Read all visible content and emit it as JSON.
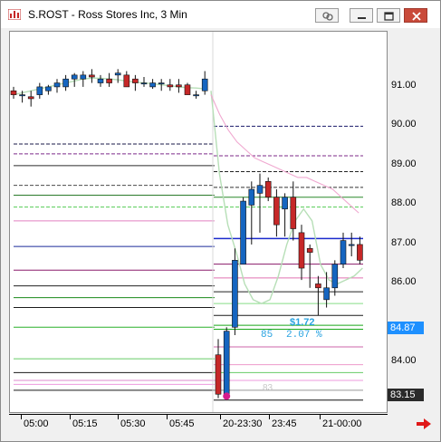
{
  "window": {
    "title": "S.ROST - Ross Stores Inc, 3 Min",
    "buttons": [
      "link",
      "minimize",
      "maximize",
      "close"
    ]
  },
  "chart_data": {
    "type": "candlestick",
    "symbol": "S.ROST",
    "name": "Ross Stores Inc",
    "interval": "3 Min",
    "ylim": [
      82.7,
      92.4
    ],
    "y_ticks": [
      "91.00",
      "90.00",
      "89.00",
      "88.00",
      "87.00",
      "86.00",
      "84.00"
    ],
    "x_ticks": [
      "05:00",
      "05:15",
      "05:30",
      "05:45",
      "20-23:30",
      "23:45",
      "21-00:00"
    ],
    "price_tags": [
      {
        "value": 84.87,
        "label": "84.87",
        "color": "#1e90ff"
      },
      {
        "value": 83.15,
        "label": "83.15",
        "color": "#2a2a2a"
      }
    ],
    "annotations": {
      "change": "$1.72",
      "change_pct": "2.07 %",
      "bar_count": "85",
      "low_bar_label": "83"
    },
    "candles_session1": [
      [
        90.9,
        91.0,
        90.7,
        90.8
      ],
      [
        90.8,
        90.9,
        90.6,
        90.8
      ],
      [
        90.75,
        90.9,
        90.5,
        90.7
      ],
      [
        90.8,
        91.1,
        90.7,
        91.0
      ],
      [
        90.9,
        91.05,
        90.8,
        91.0
      ],
      [
        91.0,
        91.2,
        90.85,
        91.1
      ],
      [
        91.0,
        91.3,
        90.9,
        91.2
      ],
      [
        91.2,
        91.35,
        91.0,
        91.3
      ],
      [
        91.2,
        91.4,
        91.0,
        91.3
      ],
      [
        91.3,
        91.45,
        91.1,
        91.25
      ],
      [
        91.1,
        91.3,
        91.0,
        91.2
      ],
      [
        91.2,
        91.35,
        91.0,
        91.1
      ],
      [
        91.3,
        91.45,
        91.1,
        91.35
      ],
      [
        91.3,
        91.4,
        91.0,
        91.0
      ],
      [
        91.2,
        91.3,
        90.9,
        91.1
      ],
      [
        91.1,
        91.25,
        91.0,
        91.1
      ],
      [
        91.0,
        91.2,
        90.95,
        91.1
      ],
      [
        91.1,
        91.2,
        90.9,
        91.1
      ],
      [
        91.05,
        91.2,
        90.9,
        91.0
      ],
      [
        91.05,
        91.2,
        90.85,
        91.0
      ],
      [
        91.05,
        91.1,
        90.8,
        90.8
      ],
      [
        90.8,
        90.9,
        90.7,
        90.8
      ],
      [
        90.9,
        91.4,
        90.8,
        91.2
      ]
    ],
    "candles_session2": [
      [
        84.2,
        84.6,
        83.1,
        83.2
      ],
      [
        83.2,
        84.9,
        83.1,
        84.8
      ],
      [
        84.9,
        86.9,
        84.7,
        86.6
      ],
      [
        86.5,
        88.2,
        86.5,
        88.1
      ],
      [
        88.0,
        88.6,
        87.0,
        88.4
      ],
      [
        88.3,
        88.8,
        87.3,
        88.5
      ],
      [
        88.6,
        88.7,
        88.1,
        88.2
      ],
      [
        88.2,
        88.4,
        87.2,
        87.5
      ],
      [
        87.9,
        88.3,
        87.2,
        88.2
      ],
      [
        88.2,
        88.6,
        87.1,
        87.4
      ],
      [
        87.3,
        87.5,
        86.1,
        86.4
      ],
      [
        86.9,
        87.0,
        85.9,
        86.8
      ],
      [
        86.0,
        86.2,
        85.2,
        85.9
      ],
      [
        85.6,
        86.3,
        85.4,
        85.9
      ],
      [
        85.9,
        86.6,
        85.7,
        86.5
      ],
      [
        86.5,
        87.3,
        86.4,
        87.1
      ],
      [
        87.0,
        87.3,
        86.7,
        87.0
      ],
      [
        87.0,
        87.2,
        86.5,
        86.6
      ]
    ],
    "ma_session1": [
      90.8,
      90.85,
      90.9,
      90.95,
      91.0,
      91.05,
      91.1,
      91.15,
      91.2,
      91.22,
      91.22,
      91.2,
      91.18,
      91.15,
      91.12,
      91.1,
      91.08,
      91.05,
      91.03,
      91.0,
      90.98,
      90.97,
      90.95
    ],
    "ma_session2_green": [
      90.9,
      88.8,
      87.5,
      86.8,
      86.0,
      85.6,
      85.5,
      85.6,
      86.2,
      87.0,
      87.6,
      87.9,
      87.6,
      86.5,
      86.1,
      86.0,
      86.1,
      86.2,
      86.4
    ],
    "ma_session2_pink": [
      90.8,
      90.3,
      89.9,
      89.6,
      89.4,
      89.2,
      89.1,
      89.0,
      88.9,
      88.8,
      88.7,
      88.7,
      88.6,
      88.5,
      88.4,
      88.2,
      88.0,
      87.8
    ],
    "levels_left": [
      {
        "y": 89.55,
        "color": "#1a1a4a",
        "dash": true
      },
      {
        "y": 89.3,
        "color": "#7d2a8a",
        "dash": true
      },
      {
        "y": 89.0,
        "color": "#2a2a2a",
        "dash": false
      },
      {
        "y": 88.5,
        "color": "#4a4a4a",
        "dash": true
      },
      {
        "y": 88.25,
        "color": "#2a7a2a",
        "dash": false
      },
      {
        "y": 87.95,
        "color": "#55cc55",
        "dash": true
      },
      {
        "y": 87.6,
        "color": "#e080c0",
        "dash": false
      },
      {
        "y": 86.95,
        "color": "#1a2a9a",
        "dash": false
      },
      {
        "y": 86.35,
        "color": "#8a1a6a",
        "dash": false
      },
      {
        "y": 85.95,
        "color": "#222222",
        "dash": false
      },
      {
        "y": 85.65,
        "color": "#1a8a1a",
        "dash": false
      },
      {
        "y": 85.4,
        "color": "#1a1a1a",
        "dash": false
      },
      {
        "y": 84.9,
        "color": "#2ab02a",
        "dash": false
      },
      {
        "y": 84.1,
        "color": "#66cc66",
        "dash": false
      },
      {
        "y": 83.75,
        "color": "#1a1a1a",
        "dash": false
      },
      {
        "y": 83.55,
        "color": "#dd88cc",
        "dash": false
      },
      {
        "y": 83.45,
        "color": "#ee99dd",
        "dash": false
      },
      {
        "y": 83.3,
        "color": "#1a1a1a",
        "dash": false
      }
    ],
    "levels_right": [
      {
        "y": 90.0,
        "color": "#1a1a6a",
        "dash": true
      },
      {
        "y": 89.25,
        "color": "#7d2a8a",
        "dash": true
      },
      {
        "y": 88.85,
        "color": "#222",
        "dash": true
      },
      {
        "y": 88.45,
        "color": "#333",
        "dash": true
      },
      {
        "y": 88.2,
        "color": "#2a8a2a",
        "dash": false
      },
      {
        "y": 87.95,
        "color": "#55cc55",
        "dash": true
      },
      {
        "y": 87.15,
        "color": "#1a2acc",
        "dash": false
      },
      {
        "y": 86.5,
        "color": "#8a1a6a",
        "dash": false
      },
      {
        "y": 86.15,
        "color": "#e070b0",
        "dash": false
      },
      {
        "y": 85.8,
        "color": "#222",
        "dash": false
      },
      {
        "y": 85.5,
        "color": "#88dd88",
        "dash": false
      },
      {
        "y": 85.2,
        "color": "#1a1a1a",
        "dash": false
      },
      {
        "y": 84.95,
        "color": "#1aa81a",
        "dash": false
      },
      {
        "y": 84.85,
        "color": "#1aa81a",
        "dash": false
      },
      {
        "y": 84.4,
        "color": "#cc66aa",
        "dash": false
      },
      {
        "y": 83.95,
        "color": "#ee99cc",
        "dash": false
      },
      {
        "y": 83.75,
        "color": "#66cc66",
        "dash": false
      },
      {
        "y": 83.55,
        "color": "#ee99dd",
        "dash": false
      },
      {
        "y": 83.3,
        "color": "#999999",
        "dash": false
      },
      {
        "y": 83.05,
        "color": "#111111",
        "dash": false
      }
    ],
    "colors": {
      "up": "#1565c0",
      "down": "#c62828",
      "ma_green": "#b7dfb7",
      "ma_pink": "#f0a8d0",
      "annotation": "#29a3e0"
    }
  }
}
